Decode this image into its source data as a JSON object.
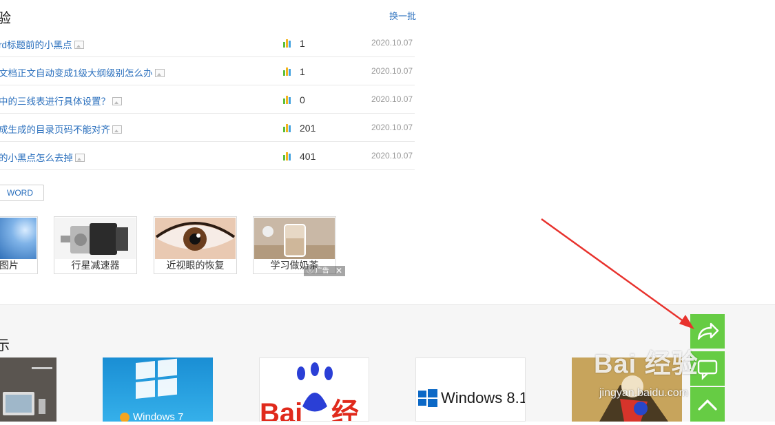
{
  "header": {
    "title": "验",
    "refresh_label": "换一批"
  },
  "articles": [
    {
      "title": "rd标题前的小黑点",
      "count": "1",
      "date": "2020.10.07"
    },
    {
      "title": "文档正文自动变成1级大纲级别怎么办",
      "count": "1",
      "date": "2020.10.07"
    },
    {
      "title": "中的三线表进行具体设置？",
      "count": "0",
      "date": "2020.10.07"
    },
    {
      "title": "成生成的目录页码不能对齐",
      "count": "201",
      "date": "2020.10.07"
    },
    {
      "title": "的小黑点怎么去掉",
      "count": "401",
      "date": "2020.10.07"
    }
  ],
  "tag": {
    "label": "WORD"
  },
  "related": [
    {
      "caption": "图片",
      "icon": "abstract-blue-thumbnail"
    },
    {
      "caption": "行星减速器",
      "icon": "gearbox-thumbnail"
    },
    {
      "caption": "近视眼的恢复",
      "icon": "eye-thumbnail"
    },
    {
      "caption": "学习做奶茶",
      "icon": "milk-tea-thumbnail"
    }
  ],
  "ad_badge": {
    "label": "广告",
    "close": "✕"
  },
  "lower": {
    "title": "示",
    "cards": [
      {
        "label": "",
        "icon": "laptop-thumbnail"
      },
      {
        "label": "Windows 7",
        "icon": "windows7-thumbnail"
      },
      {
        "label": "",
        "icon": "baidu-jingyan-thumbnail"
      },
      {
        "label": "Windows 8.1",
        "icon": "windows81-thumbnail"
      },
      {
        "label": "",
        "icon": "cartoon-thumbnail"
      }
    ]
  },
  "float_buttons": [
    {
      "icon": "share-icon"
    },
    {
      "icon": "feedback-icon"
    },
    {
      "icon": "back-to-top-icon"
    }
  ],
  "watermark": {
    "brand": "Bai 经验",
    "url": "jingyan.baidu.com"
  },
  "colors": {
    "link": "#2a6fbd",
    "green": "#66cc44",
    "arrow": "#e8322d"
  }
}
